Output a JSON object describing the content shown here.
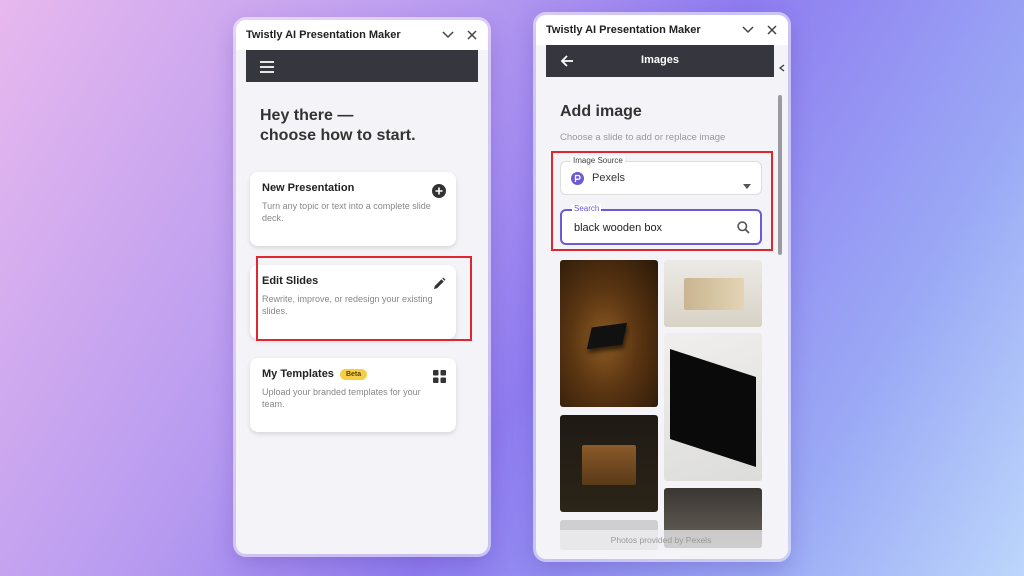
{
  "left": {
    "window_title": "Twistly AI Presentation Maker",
    "heading_line1": "Hey there —",
    "heading_line2": "choose how to start.",
    "cards": [
      {
        "title": "New Presentation",
        "desc": "Turn any topic or text into a complete slide deck.",
        "icon": "plus-circle-icon"
      },
      {
        "title": "Edit Slides",
        "desc": "Rewrite, improve, or redesign your existing slides.",
        "icon": "pencil-icon"
      },
      {
        "title": "My Templates",
        "badge": "Beta",
        "desc": "Upload your branded templates for your team.",
        "icon": "grid-icon"
      }
    ]
  },
  "right": {
    "window_title": "Twistly AI Presentation Maker",
    "appbar_title": "Images",
    "heading": "Add image",
    "subtitle": "Choose a slide to add or replace image",
    "source_label": "Image Source",
    "source_value": "Pexels",
    "search_label": "Search",
    "search_value": "black wooden box",
    "footer_text": "Photos provided by Pexels"
  },
  "colors": {
    "appbar": "#36363e",
    "accent": "#6b5bd6",
    "highlight": "#e0262f",
    "beta_badge": "#f5cf4a"
  }
}
